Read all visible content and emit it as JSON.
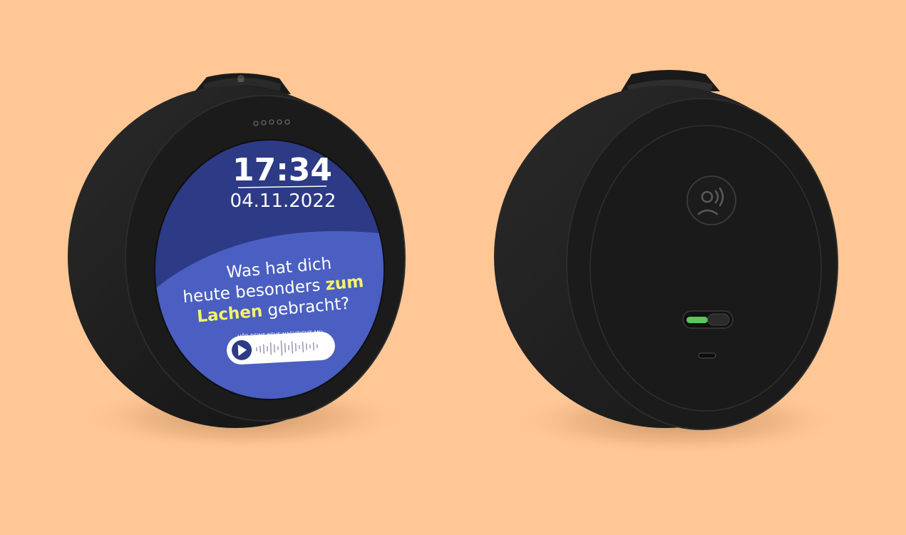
{
  "background_color": "#FFC795",
  "device_color": "#1E1E1E",
  "front_device": {
    "screen": {
      "time": "17:34",
      "date": "04.11.2022",
      "question_line1": "Was hat dich",
      "question_line2_pre": "heute besonders ",
      "question_line2_highlight": "zum",
      "question_line3_highlight": "Lachen",
      "question_line3_post": " gebracht?",
      "message_prompt": "HÖR DEINE NEUE NACHRICHT AN!",
      "play_icon": "play-icon",
      "waveform_icon": "audio-waveform-icon",
      "top_color": "#2D3A86",
      "bottom_color": "#4A5FC1",
      "highlight_color": "#F5F36A"
    },
    "top_button_icon": "lock-icon"
  },
  "back_device": {
    "emblem_icon": "speaking-person-icon",
    "power_switch": {
      "state": "on",
      "indicator_color": "#5CC65A"
    },
    "charging_port_icon": "usb-c-port-icon"
  }
}
